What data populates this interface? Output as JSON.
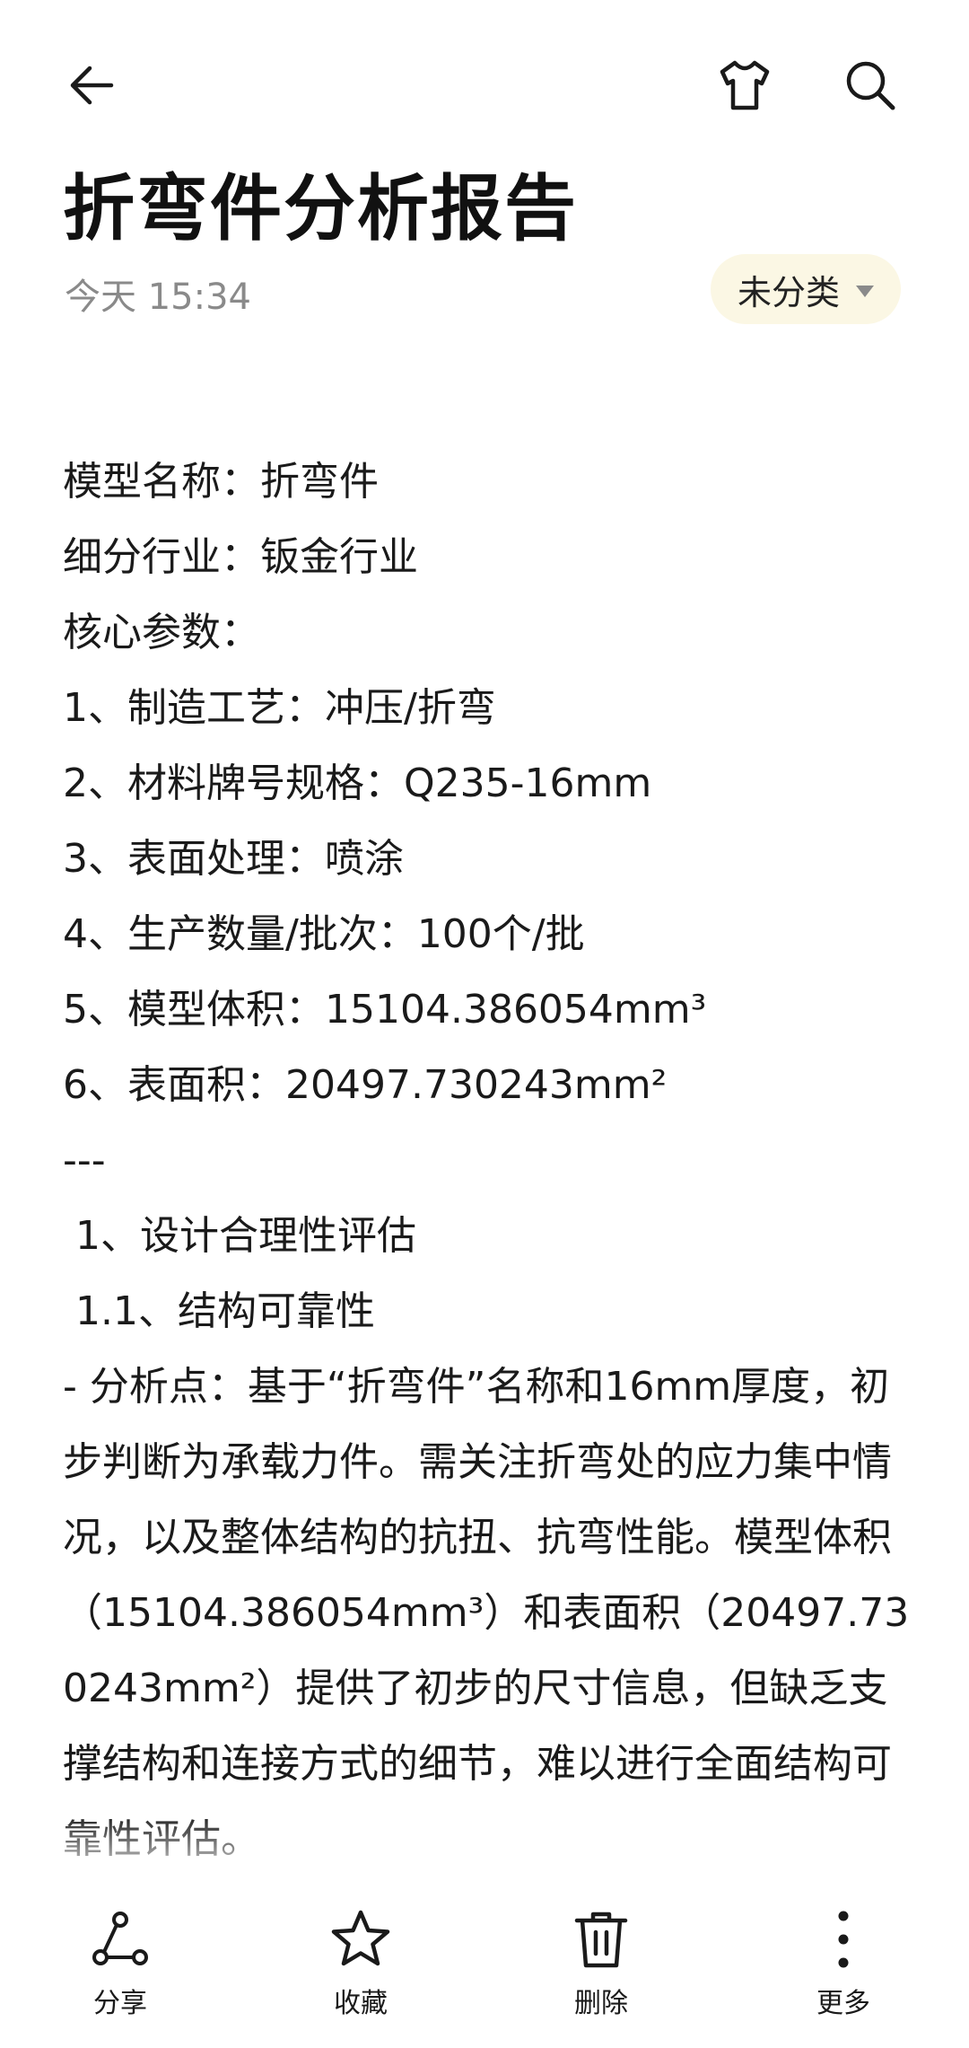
{
  "header": {
    "back_icon": "arrow-left-icon",
    "theme_icon": "tshirt-icon",
    "search_icon": "search-icon"
  },
  "note": {
    "title": "折弯件分析报告",
    "time": "今天 15:34",
    "category": "未分类"
  },
  "body": {
    "lines": [
      "模型名称：折弯件",
      "细分行业：钣金行业",
      "核心参数：",
      "1、制造工艺：冲压/折弯",
      "2、材料牌号规格：Q235-16mm",
      "3、表面处理：喷涂",
      "4、生产数量/批次：100个/批",
      "5、模型体积：15104.386054mm³",
      "6、表面积：20497.730243mm²",
      "---",
      " 1、设计合理性评估",
      " 1.1、结构可靠性"
    ],
    "paragraph": "- 分析点：基于“折弯件”名称和16mm厚度，初步判断为承载力件。需关注折弯处的应力集中情况，以及整体结构的抗扭、抗弯性能。模型体积（15104.386054mm³）和表面积（20497.730243mm²）提供了初步的尺寸信息，但缺乏支撑结构和连接方式的细节，难以进行全面结构可靠性评估。"
  },
  "bottom_bar": {
    "share": "分享",
    "favorite": "收藏",
    "delete": "删除",
    "more": "更多"
  },
  "colors": {
    "chip_bg": "#fbf7e4",
    "meta_text": "#8a8a8a",
    "text": "#1a1a1a"
  }
}
